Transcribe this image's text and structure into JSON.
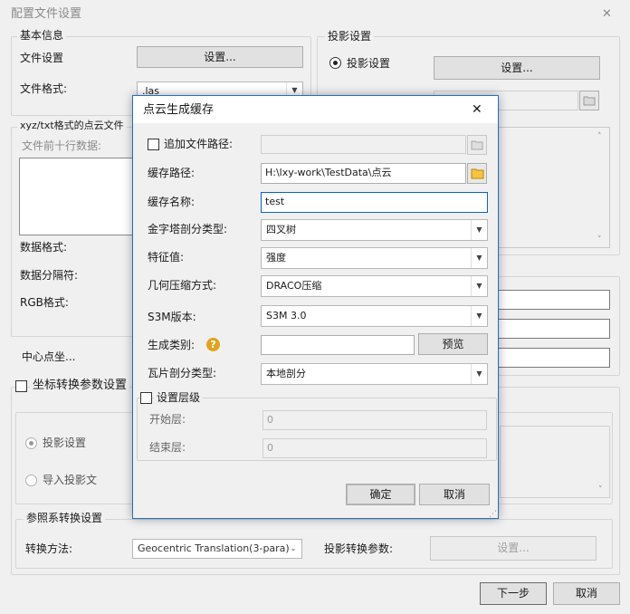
{
  "window": {
    "title": "配置文件设置",
    "close_glyph": "✕"
  },
  "basic_info": {
    "group_title": "基本信息",
    "file_settings_label": "文件设置",
    "file_settings_button": "设置...",
    "file_format_label": "文件格式:",
    "file_format_value": ".las"
  },
  "projection": {
    "group_title": "投影设置",
    "radio_projection_label": "投影设置",
    "settings_button": "设置...",
    "radio_import_label": "导入投影文"
  },
  "xyz_group": {
    "group_title": "xyz/txt格式的点云文件",
    "preview_label": "文件前十行数据:",
    "data_format_label": "数据格式:",
    "separator_label": "数据分隔符:",
    "rgb_format_label": "RGB格式:",
    "center_point_label": "中心点坐..."
  },
  "coord_transform": {
    "checkbox_label": "坐标转换参数设置",
    "radio_projection_label": "投影设置",
    "radio_import_label": "导入投影文"
  },
  "ref_transform": {
    "group_title": "参照系转换设置",
    "method_label": "转换方法:",
    "method_value": "Geocentric Translation(3-para)",
    "params_label": "投影转换参数:",
    "params_button": "设置..."
  },
  "footer": {
    "next_button": "下一步",
    "cancel_button": "取消"
  },
  "dialog": {
    "title": "点云生成缓存",
    "close_glyph": "✕",
    "append_path_label": "追加文件路径:",
    "append_path_value": "",
    "cache_path_label": "缓存路径:",
    "cache_path_value": "H:\\lxy-work\\TestData\\点云",
    "cache_name_label": "缓存名称:",
    "cache_name_value": "test",
    "pyramid_label": "金字塔剖分类型:",
    "pyramid_value": "四叉树",
    "feature_label": "特征值:",
    "feature_value": "强度",
    "compression_label": "几何压缩方式:",
    "compression_value": "DRACO压缩",
    "s3m_label": "S3M版本:",
    "s3m_value": "S3M 3.0",
    "category_label": "生成类别:",
    "category_help": "?",
    "category_value": "",
    "preview_button": "预览",
    "tile_label": "瓦片剖分类型:",
    "tile_value": "本地剖分",
    "levels_checkbox_label": "设置层级",
    "start_level_label": "开始层:",
    "start_level_value": "0",
    "end_level_label": "结束层:",
    "end_level_value": "0",
    "ok_button": "确定",
    "cancel_button": "取消"
  }
}
